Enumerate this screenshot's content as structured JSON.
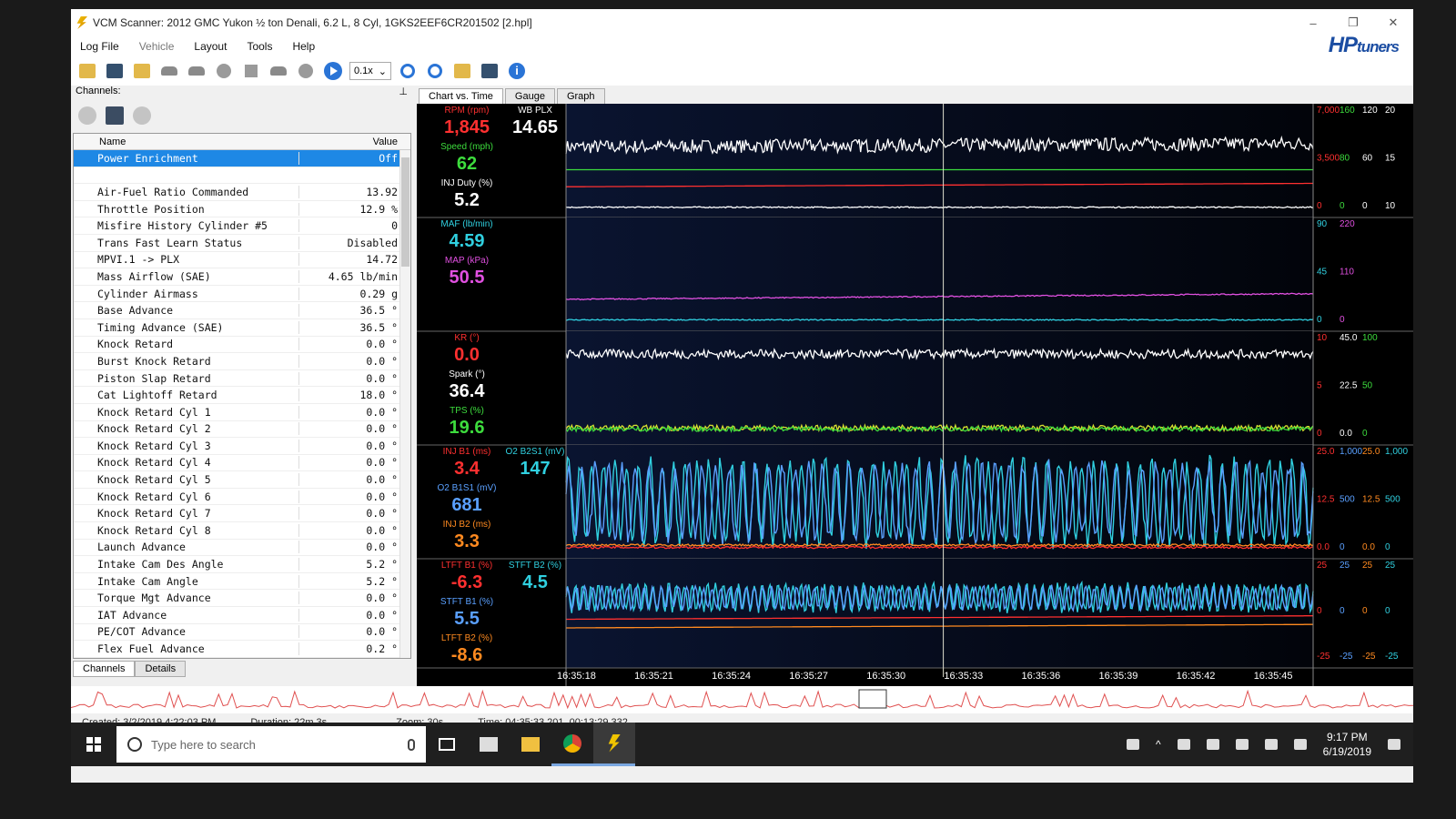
{
  "window": {
    "title": "VCM Scanner: 2012 GMC Yukon ½ ton Denali, 6.2 L, 8 Cyl, 1GKS2EEF6CR201502 [2.hpl]",
    "brand_main": "HP",
    "brand_sub": "tuners"
  },
  "menu": [
    "Log File",
    "Vehicle",
    "Layout",
    "Tools",
    "Help"
  ],
  "toolbar": {
    "rate": "0.1x"
  },
  "channels_panel": {
    "title": "Channels:",
    "col_name": "Name",
    "col_value": "Value",
    "rows": [
      {
        "name": "Power Enrichment",
        "value": "Off"
      },
      {
        "name": "",
        "value": ""
      },
      {
        "name": "Air-Fuel Ratio Commanded",
        "value": "13.92"
      },
      {
        "name": "Throttle Position",
        "value": "12.9 %"
      },
      {
        "name": "Misfire History Cylinder #5",
        "value": "0"
      },
      {
        "name": "Trans Fast Learn Status",
        "value": "Disabled"
      },
      {
        "name": "MPVI.1 -> PLX",
        "value": "14.72"
      },
      {
        "name": "Mass Airflow (SAE)",
        "value": "4.65 lb/min"
      },
      {
        "name": "Cylinder Airmass",
        "value": "0.29 g"
      },
      {
        "name": "Base Advance",
        "value": "36.5 °"
      },
      {
        "name": "Timing Advance (SAE)",
        "value": "36.5 °"
      },
      {
        "name": "Knock Retard",
        "value": "0.0 °"
      },
      {
        "name": "Burst Knock Retard",
        "value": "0.0 °"
      },
      {
        "name": "Piston Slap Retard",
        "value": "0.0 °"
      },
      {
        "name": "Cat Lightoff Retard",
        "value": "18.0 °"
      },
      {
        "name": "Knock Retard Cyl 1",
        "value": "0.0 °"
      },
      {
        "name": "Knock Retard Cyl 2",
        "value": "0.0 °"
      },
      {
        "name": "Knock Retard Cyl 3",
        "value": "0.0 °"
      },
      {
        "name": "Knock Retard Cyl 4",
        "value": "0.0 °"
      },
      {
        "name": "Knock Retard Cyl 5",
        "value": "0.0 °"
      },
      {
        "name": "Knock Retard Cyl 6",
        "value": "0.0 °"
      },
      {
        "name": "Knock Retard Cyl 7",
        "value": "0.0 °"
      },
      {
        "name": "Knock Retard Cyl 8",
        "value": "0.0 °"
      },
      {
        "name": "Launch Advance",
        "value": "0.0 °"
      },
      {
        "name": "Intake Cam Des Angle",
        "value": "5.2 °"
      },
      {
        "name": "Intake Cam Angle",
        "value": "5.2 °"
      },
      {
        "name": "Torque Mgt Advance",
        "value": "0.0 °"
      },
      {
        "name": "IAT Advance",
        "value": "0.0 °"
      },
      {
        "name": "PE/COT Advance",
        "value": "0.0 °"
      },
      {
        "name": "Flex Fuel Advance",
        "value": "0.2 °"
      }
    ],
    "tabs": [
      "Channels",
      "Details"
    ]
  },
  "chart_tabs": [
    "Chart vs. Time",
    "Gauge",
    "Graph"
  ],
  "colors": {
    "red": "#ff3030",
    "green": "#3ddc3d",
    "white": "#ffffff",
    "cyan": "#30d0e0",
    "magenta": "#e050e0",
    "orange": "#ff8a20",
    "blue": "#5aa0ff",
    "yellow": "#d8e030"
  },
  "chart_data": {
    "type": "line",
    "x_ticks": [
      "16:35:18",
      "16:35:21",
      "16:35:24",
      "16:35:27",
      "16:35:30",
      "16:35:33",
      "16:35:36",
      "16:35:39",
      "16:35:42",
      "16:35:45"
    ],
    "cursor_time": "16:35:33",
    "panes": [
      {
        "readouts": [
          {
            "name": "RPM (rpm)",
            "value": "1,845",
            "color": "red"
          },
          {
            "name": "WB PLX",
            "value": "14.65",
            "color": "white"
          },
          {
            "name": "Speed (mph)",
            "value": "62",
            "color": "green"
          },
          {
            "name": "INJ Duty (%)",
            "value": "5.2",
            "color": "white"
          }
        ],
        "axes": [
          {
            "values": [
              "7,000",
              "3,500",
              "0"
            ],
            "color": "red"
          },
          {
            "values": [
              "160",
              "80",
              "0"
            ],
            "color": "green"
          },
          {
            "values": [
              "120",
              "60",
              "0"
            ],
            "color": "white"
          },
          {
            "values": [
              "20",
              "15",
              "10"
            ],
            "color": "white"
          }
        ],
        "series": [
          {
            "color": "white",
            "level": 0.62,
            "noise": 0.06,
            "trend": 0.03
          },
          {
            "color": "green",
            "level": 0.42,
            "noise": 0.0
          },
          {
            "color": "red",
            "level": 0.27,
            "noise": 0.0,
            "trend": 0.03
          },
          {
            "color": "white",
            "level": 0.09,
            "noise": 0.005
          }
        ]
      },
      {
        "readouts": [
          {
            "name": "MAF (lb/min)",
            "value": "4.59",
            "color": "cyan"
          },
          {
            "name": "MAP (kPa)",
            "value": "50.5",
            "color": "magenta"
          }
        ],
        "axes": [
          {
            "values": [
              "90",
              "45",
              "0"
            ],
            "color": "cyan"
          },
          {
            "values": [
              "220",
              "110",
              "0"
            ],
            "color": "magenta"
          }
        ],
        "series": [
          {
            "color": "magenta",
            "level": 0.28,
            "noise": 0.005,
            "trend": 0.05
          },
          {
            "color": "cyan",
            "level": 0.1,
            "noise": 0.005
          }
        ]
      },
      {
        "readouts": [
          {
            "name": "KR (°)",
            "value": "0.0",
            "color": "red"
          },
          {
            "name": "Spark (°)",
            "value": "36.4",
            "color": "white"
          },
          {
            "name": "TPS (%)",
            "value": "19.6",
            "color": "green"
          }
        ],
        "axes": [
          {
            "values": [
              "10",
              "5",
              "0"
            ],
            "color": "red"
          },
          {
            "values": [
              "45.0",
              "22.5",
              "0.0"
            ],
            "color": "white"
          },
          {
            "values": [
              "100",
              "50",
              "0"
            ],
            "color": "green"
          }
        ],
        "series": [
          {
            "color": "white",
            "level": 0.8,
            "noise": 0.04
          },
          {
            "color": "yellow",
            "level": 0.15,
            "noise": 0.025
          },
          {
            "color": "green",
            "level": 0.14,
            "noise": 0.02
          }
        ]
      },
      {
        "readouts": [
          {
            "name": "INJ B1 (ms)",
            "value": "3.4",
            "color": "red"
          },
          {
            "name": "O2 B2S1 (mV)",
            "value": "147",
            "color": "cyan"
          },
          {
            "name": "O2 B1S1 (mV)",
            "value": "681",
            "color": "blue"
          },
          {
            "name": "INJ B2 (ms)",
            "value": "3.3",
            "color": "orange"
          }
        ],
        "axes": [
          {
            "values": [
              "25.0",
              "12.5",
              "0.0"
            ],
            "color": "red"
          },
          {
            "values": [
              "1,000",
              "500",
              "0"
            ],
            "color": "blue"
          },
          {
            "values": [
              "25.0",
              "12.5",
              "0.0"
            ],
            "color": "orange"
          },
          {
            "values": [
              "1,000",
              "500",
              "0"
            ],
            "color": "cyan"
          }
        ],
        "series": [
          {
            "color": "cyan",
            "level": 0.5,
            "osc": 0.42,
            "freq": 1.6
          },
          {
            "color": "blue",
            "level": 0.5,
            "osc": 0.38,
            "freq": 1.4
          },
          {
            "color": "orange",
            "level": 0.12,
            "noise": 0.01
          },
          {
            "color": "red",
            "level": 0.1,
            "noise": 0.01
          }
        ]
      },
      {
        "readouts": [
          {
            "name": "LTFT B1 (%)",
            "value": "-6.3",
            "color": "red"
          },
          {
            "name": "STFT B2 (%)",
            "value": "4.5",
            "color": "cyan"
          },
          {
            "name": "STFT B1 (%)",
            "value": "5.5",
            "color": "blue"
          },
          {
            "name": "LTFT B2 (%)",
            "value": "-8.6",
            "color": "orange"
          }
        ],
        "axes": [
          {
            "values": [
              "25",
              "0",
              "-25"
            ],
            "color": "red"
          },
          {
            "values": [
              "25",
              "0",
              "-25"
            ],
            "color": "blue"
          },
          {
            "values": [
              "25",
              "0",
              "-25"
            ],
            "color": "orange"
          },
          {
            "values": [
              "25",
              "0",
              "-25"
            ],
            "color": "cyan"
          }
        ],
        "series": [
          {
            "color": "cyan",
            "level": 0.55,
            "osc": 0.18,
            "freq": 2.4
          },
          {
            "color": "blue",
            "level": 0.55,
            "osc": 0.15,
            "freq": 2.2
          },
          {
            "color": "red",
            "level": 0.3,
            "noise": 0.0,
            "trend": 0.04
          },
          {
            "color": "orange",
            "level": 0.2,
            "noise": 0.0,
            "trend": 0.04
          }
        ]
      }
    ]
  },
  "status": {
    "created": "Created: 3/2/2019 4:22:03 PM",
    "duration": "Duration: 22m 3s",
    "zoom": "Zoom: 30s",
    "time": "Time: 04:35:33.201, 00:13:29.332"
  },
  "taskbar": {
    "search_placeholder": "Type here to search",
    "clock_time": "9:17 PM",
    "clock_date": "6/19/2019"
  }
}
